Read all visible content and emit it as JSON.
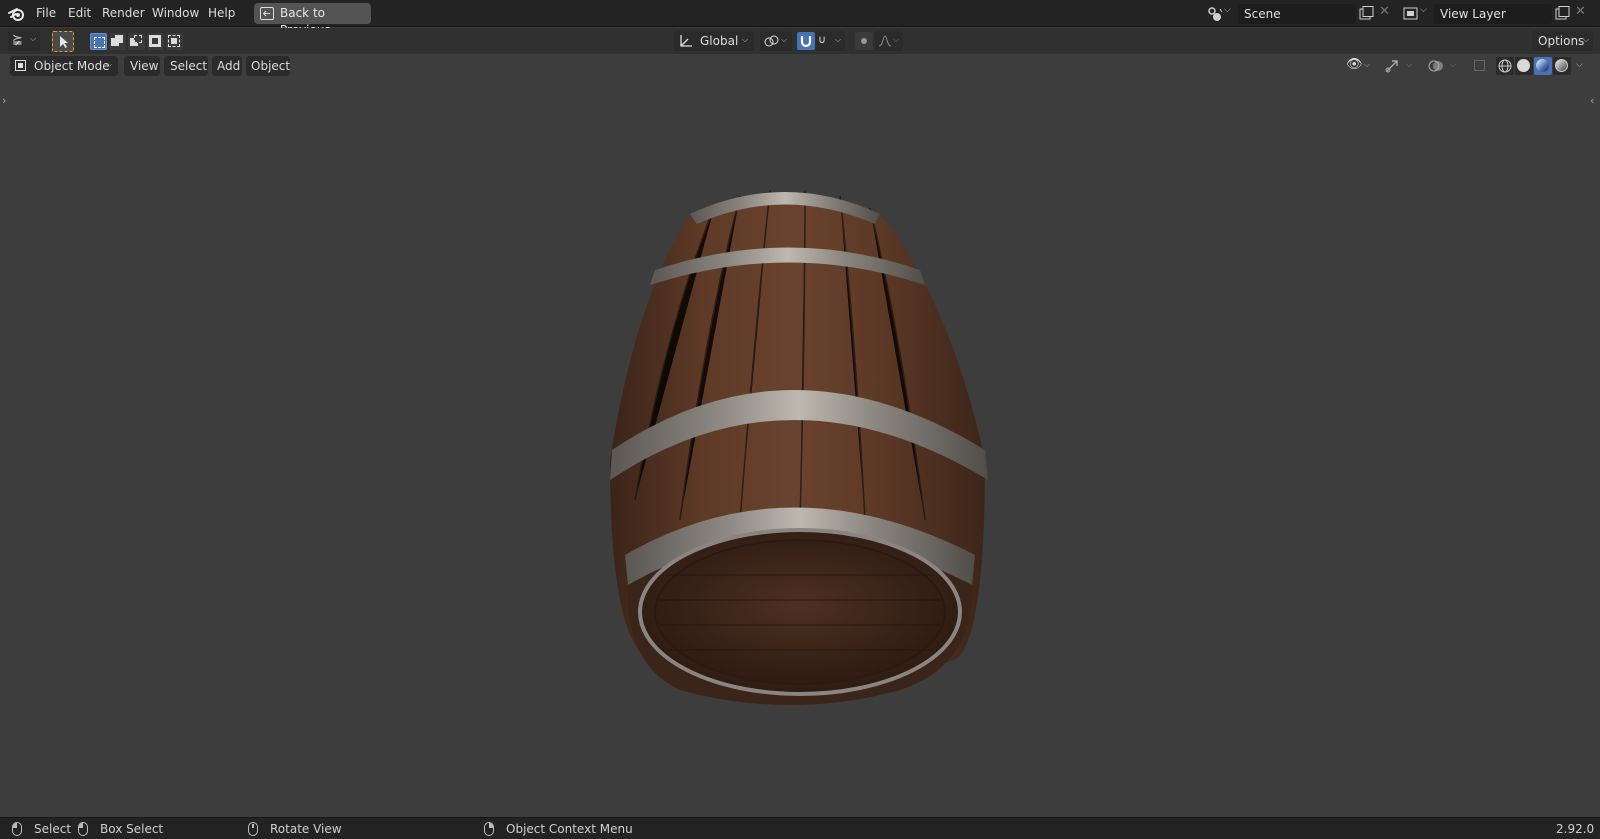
{
  "menu": {
    "file": "File",
    "edit": "Edit",
    "render": "Render",
    "window": "Window",
    "help": "Help"
  },
  "back_button": "Back to Previous",
  "scene": {
    "value": "Scene"
  },
  "view_layer": {
    "value": "View Layer"
  },
  "toolbar": {
    "orientation": "Global",
    "options": "Options"
  },
  "viewport_header": {
    "mode": "Object Mode",
    "view": "View",
    "select": "Select",
    "add": "Add",
    "object": "Object"
  },
  "status": {
    "select": "Select",
    "box_select": "Box Select",
    "rotate_view": "Rotate View",
    "context_menu": "Object Context Menu",
    "version": "2.92.0"
  },
  "icons": {
    "logo": "blender-logo-icon",
    "back": "back-to-previous-icon",
    "scene": "scene-icon",
    "view_layer": "view-layer-icon",
    "transform_pivot": "transform-orientation-icon",
    "snap": "snap-icon",
    "proportional": "proportional-editing-icon"
  },
  "colors": {
    "accent": "#4772b3",
    "active_tool": "#545454",
    "viewport_bg": "#3d3d3d",
    "header_bg": "#232323"
  }
}
